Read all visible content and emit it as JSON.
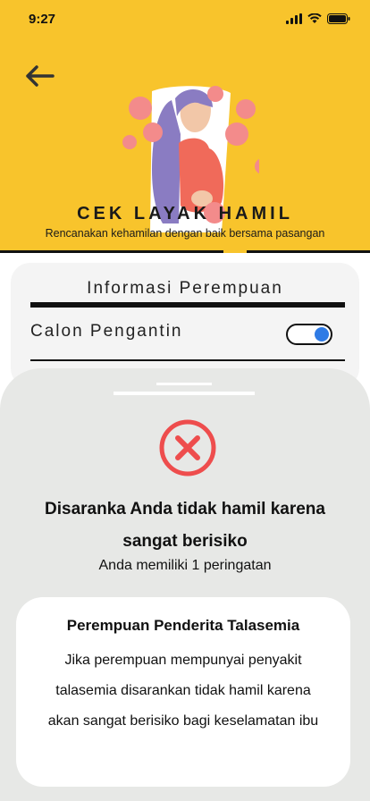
{
  "status_bar": {
    "time": "9:27"
  },
  "header": {
    "title": "CEK LAYAK HAMIL",
    "subtitle": "Rencanakan kehamilan dengan baik bersama pasangan",
    "background_color": "#f8c42c"
  },
  "info_card": {
    "title": "Informasi Perempuan",
    "toggle_label": "Calon Pengantin",
    "toggle_on": true,
    "toggle_color": "#2f7be5"
  },
  "result": {
    "icon": "x-circle-icon",
    "icon_color": "#ee4d4d",
    "title": "Disaranka Anda tidak hamil karena sangat berisiko",
    "subtitle": "Anda memiliki 1 peringatan"
  },
  "warning": {
    "title": "Perempuan Penderita Talasemia",
    "body": "Jika perempuan mempunyai penyakit talasemia disarankan tidak hamil karena akan sangat berisiko bagi keselamatan ibu"
  }
}
